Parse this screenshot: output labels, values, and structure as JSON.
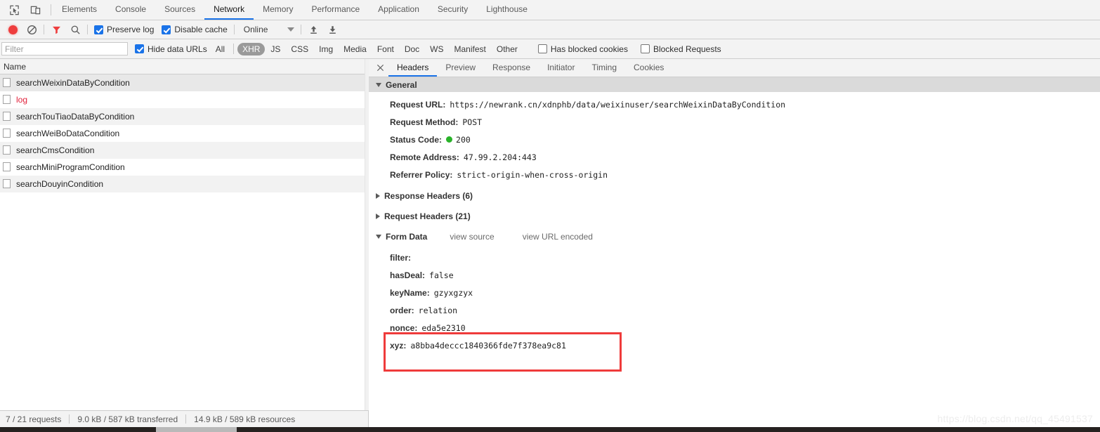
{
  "main_tabs": [
    {
      "label": "Elements",
      "selected": false
    },
    {
      "label": "Console",
      "selected": false
    },
    {
      "label": "Sources",
      "selected": false
    },
    {
      "label": "Network",
      "selected": true
    },
    {
      "label": "Memory",
      "selected": false
    },
    {
      "label": "Performance",
      "selected": false
    },
    {
      "label": "Application",
      "selected": false
    },
    {
      "label": "Security",
      "selected": false
    },
    {
      "label": "Lighthouse",
      "selected": false
    }
  ],
  "top_icons": {
    "inspect": "inspect-element-icon",
    "device": "device-toolbar-icon"
  },
  "network_toolbar": {
    "record_icon": "record-stop-icon",
    "clear_icon": "clear-icon",
    "filter_icon": "filter-funnel-icon",
    "search_icon": "search-icon",
    "preserve_log_label": "Preserve log",
    "preserve_log_checked": true,
    "disable_cache_label": "Disable cache",
    "disable_cache_checked": true,
    "throttle_value": "Online",
    "import_icon": "import-har-icon",
    "export_icon": "export-har-icon"
  },
  "filter_bar": {
    "filter_placeholder": "Filter",
    "filter_value": "",
    "hide_data_urls_label": "Hide data URLs",
    "hide_data_urls_checked": true,
    "types": [
      {
        "label": "All",
        "active": false
      },
      {
        "label": "XHR",
        "active": true
      },
      {
        "label": "JS",
        "active": false
      },
      {
        "label": "CSS",
        "active": false
      },
      {
        "label": "Img",
        "active": false
      },
      {
        "label": "Media",
        "active": false
      },
      {
        "label": "Font",
        "active": false
      },
      {
        "label": "Doc",
        "active": false
      },
      {
        "label": "WS",
        "active": false
      },
      {
        "label": "Manifest",
        "active": false
      },
      {
        "label": "Other",
        "active": false
      }
    ],
    "has_blocked_cookies_label": "Has blocked cookies",
    "has_blocked_cookies_checked": false,
    "blocked_requests_label": "Blocked Requests",
    "blocked_requests_checked": false
  },
  "request_list": {
    "column_header": "Name",
    "rows": [
      {
        "name": "searchWeixinDataByCondition",
        "selected": true,
        "error": false
      },
      {
        "name": "log",
        "selected": false,
        "error": true
      },
      {
        "name": "searchTouTiaoDataByCondition",
        "selected": false,
        "error": false
      },
      {
        "name": "searchWeiBoDataCondition",
        "selected": false,
        "error": false
      },
      {
        "name": "searchCmsCondition",
        "selected": false,
        "error": false
      },
      {
        "name": "searchMiniProgramCondition",
        "selected": false,
        "error": false
      },
      {
        "name": "searchDouyinCondition",
        "selected": false,
        "error": false
      }
    ]
  },
  "detail_tabs": [
    {
      "label": "Headers",
      "selected": true
    },
    {
      "label": "Preview",
      "selected": false
    },
    {
      "label": "Response",
      "selected": false
    },
    {
      "label": "Initiator",
      "selected": false
    },
    {
      "label": "Timing",
      "selected": false
    },
    {
      "label": "Cookies",
      "selected": false
    }
  ],
  "detail": {
    "close_icon": "close-icon",
    "general": {
      "title": "General",
      "expanded": true,
      "items": [
        {
          "key": "Request URL:",
          "value": "https://newrank.cn/xdnphb/data/weixinuser/searchWeixinDataByCondition",
          "status": null
        },
        {
          "key": "Request Method:",
          "value": "POST",
          "status": null
        },
        {
          "key": "Status Code:",
          "value": "200",
          "status": "green"
        },
        {
          "key": "Remote Address:",
          "value": "47.99.2.204:443",
          "status": null
        },
        {
          "key": "Referrer Policy:",
          "value": "strict-origin-when-cross-origin",
          "status": null
        }
      ]
    },
    "response_headers": {
      "title": "Response Headers (6)",
      "expanded": false
    },
    "request_headers": {
      "title": "Request Headers (21)",
      "expanded": false
    },
    "form_data": {
      "title": "Form Data",
      "expanded": true,
      "view_source_label": "view source",
      "view_url_encoded_label": "view URL encoded",
      "items": [
        {
          "key": "filter:",
          "value": "",
          "highlighted": false
        },
        {
          "key": "hasDeal:",
          "value": "false",
          "highlighted": false
        },
        {
          "key": "keyName:",
          "value": "gzyxgzyx",
          "highlighted": false
        },
        {
          "key": "order:",
          "value": "relation",
          "highlighted": false
        },
        {
          "key": "nonce:",
          "value": "eda5e2310",
          "highlighted": true
        },
        {
          "key": "xyz:",
          "value": "a8bba4deccc1840366fde7f378ea9c81",
          "highlighted": true
        }
      ]
    }
  },
  "status_bar": {
    "requests": "7 / 21 requests",
    "transferred": "9.0 kB / 587 kB transferred",
    "resources": "14.9 kB / 589 kB resources"
  },
  "watermark": "https://blog.csdn.net/qq_45491537",
  "colors": {
    "accent": "#1a73e8",
    "record_active": "#ee3d3d",
    "filter_active": "#ee3d3d",
    "error_text": "#e2213b",
    "status_ok": "#29b329",
    "highlight_box": "#ef3b3b"
  }
}
